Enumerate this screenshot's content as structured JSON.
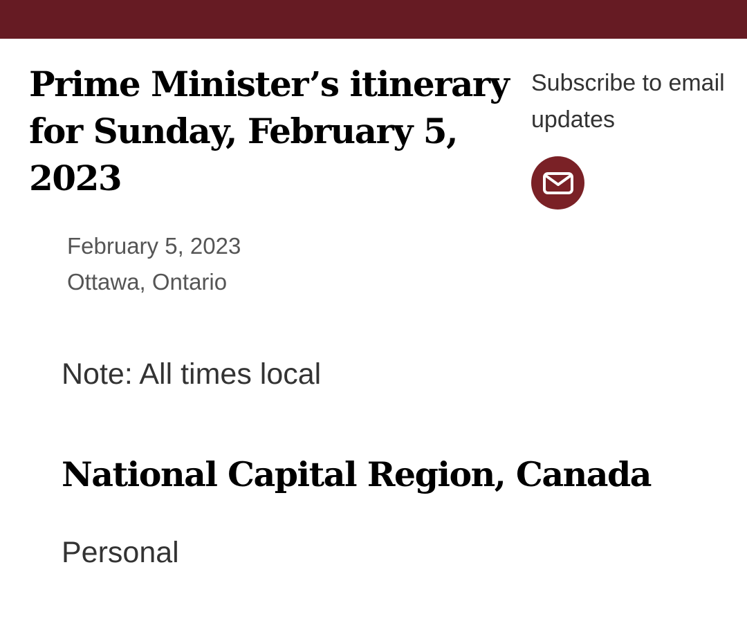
{
  "header": {
    "bar_color": "#661b23"
  },
  "article": {
    "title": "Prime Minister’s itinerary for Sunday, February 5, 2023",
    "date": "February 5, 2023",
    "location": "Ottawa, Ontario",
    "note": "Note: All times local",
    "sections": [
      {
        "heading": "National Capital Region, Canada",
        "items": [
          "Personal"
        ]
      }
    ]
  },
  "subscribe": {
    "label": "Subscribe to email updates",
    "icon": "envelope-icon",
    "button_color": "#7a2126"
  }
}
